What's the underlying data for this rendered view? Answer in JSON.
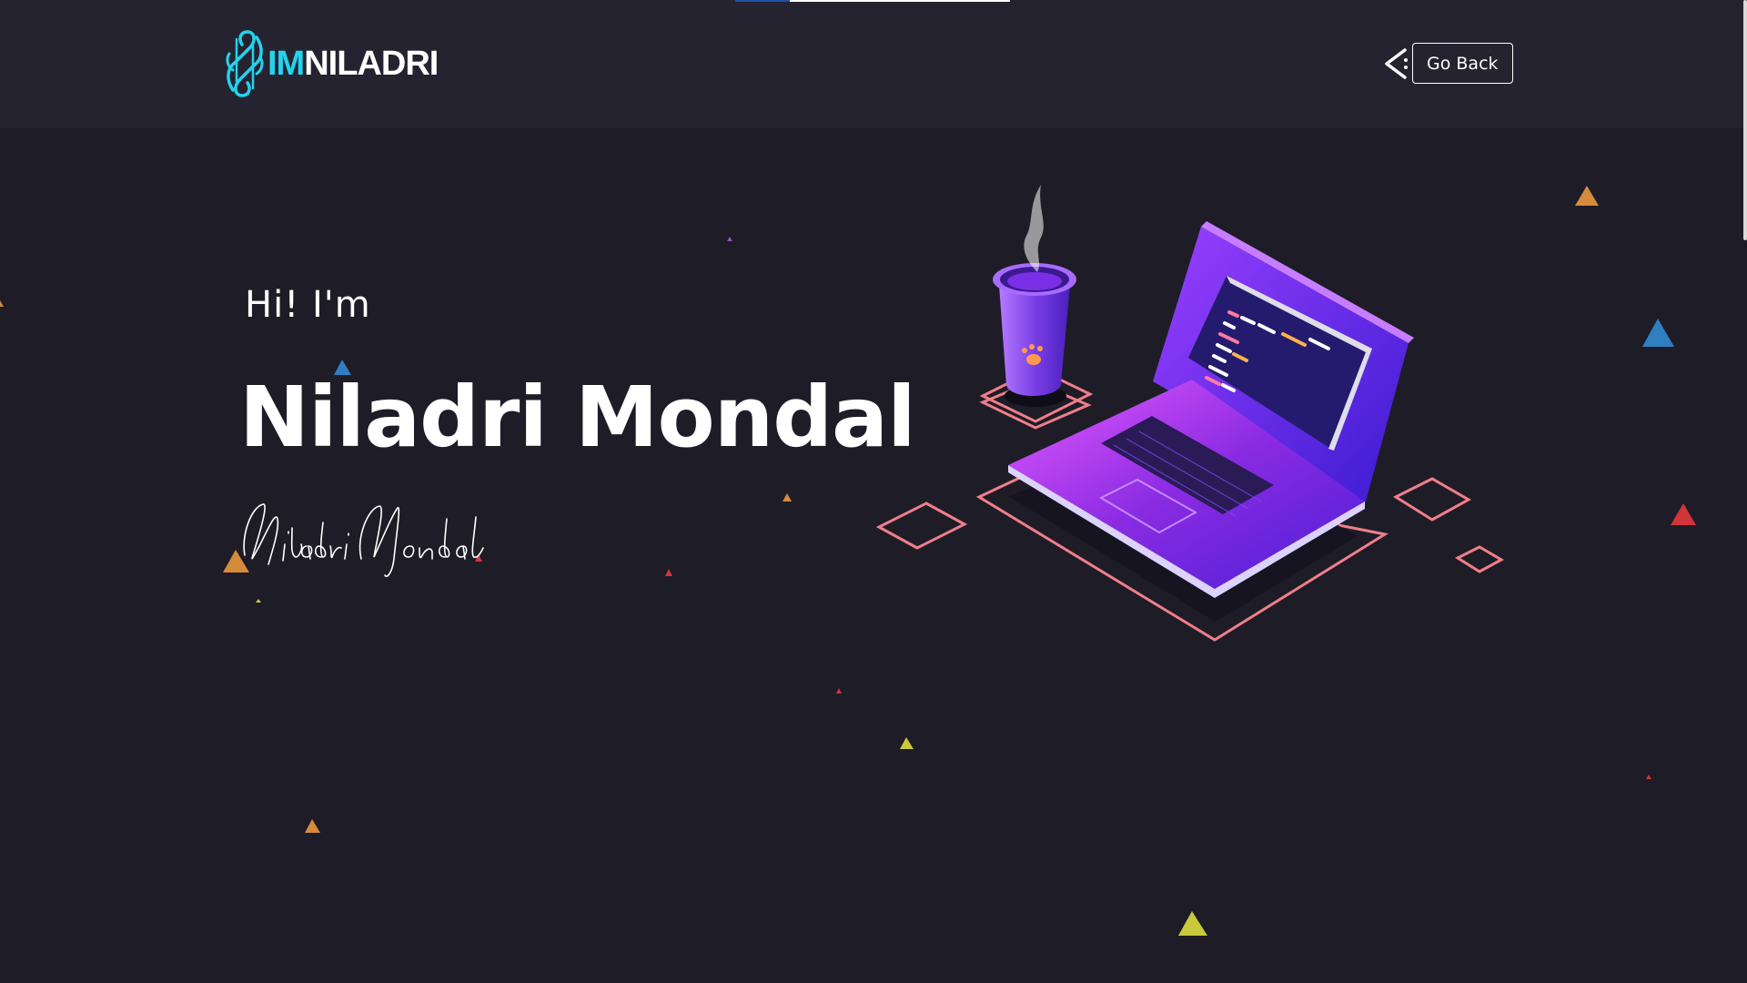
{
  "header": {
    "logo": {
      "highlight": "IM",
      "rest": "NILADRI"
    },
    "progress": 0.2,
    "go_back_label": "Go Back"
  },
  "hero": {
    "greeting": "Hi! I'm",
    "name": "Niladri Mondal",
    "signature": "Niladri Mondal"
  },
  "colors": {
    "background": "#1e1c26",
    "header_bg": "#25232f",
    "accent_cyan": "#22d3ee",
    "laptop_purple": "#7c3aed",
    "outline_pink": "#ef7f8a",
    "triangle_orange": "#d68a3c",
    "triangle_blue": "#2f7fc1",
    "triangle_red": "#d2353a",
    "triangle_yellow": "#c9c93c",
    "triangle_purple": "#9c4fc5"
  },
  "icons": {
    "logo_mark": "logo-knot-icon",
    "back": "back-chevron-icon"
  }
}
